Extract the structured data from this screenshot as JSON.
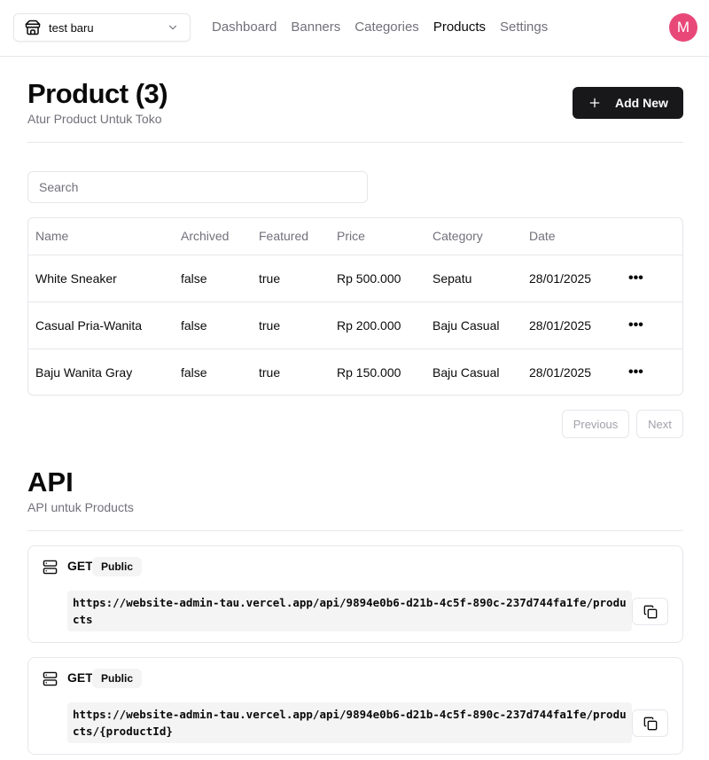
{
  "navbar": {
    "store_name": "test baru",
    "links": [
      "Dashboard",
      "Banners",
      "Categories",
      "Products",
      "Settings"
    ],
    "active_link": "Products",
    "avatar_initial": "M",
    "avatar_color": "#e84878"
  },
  "header": {
    "title": "Product (3)",
    "subtitle": "Atur Product Untuk Toko",
    "add_button_label": "Add New"
  },
  "search": {
    "placeholder": "Search",
    "value": ""
  },
  "table": {
    "columns": [
      "Name",
      "Archived",
      "Featured",
      "Price",
      "Category",
      "Date"
    ],
    "rows": [
      {
        "name": "White Sneaker",
        "archived": "false",
        "featured": "true",
        "price": "Rp 500.000",
        "category": "Sepatu",
        "date": "28/01/2025",
        "actions": "•••"
      },
      {
        "name": "Casual Pria-Wanita",
        "archived": "false",
        "featured": "true",
        "price": "Rp 200.000",
        "category": "Baju Casual",
        "date": "28/01/2025",
        "actions": "•••"
      },
      {
        "name": "Baju Wanita Gray",
        "archived": "false",
        "featured": "true",
        "price": "Rp 150.000",
        "category": "Baju Casual",
        "date": "28/01/2025",
        "actions": "•••"
      }
    ]
  },
  "pagination": {
    "previous_label": "Previous",
    "next_label": "Next"
  },
  "api": {
    "title": "API",
    "subtitle": "API untuk Products",
    "endpoints": [
      {
        "method": "GET",
        "badge": "Public",
        "url": "https://website-admin-tau.vercel.app/api/9894e0b6-d21b-4c5f-890c-237d744fa1fe/products"
      },
      {
        "method": "GET",
        "badge": "Public",
        "url": "https://website-admin-tau.vercel.app/api/9894e0b6-d21b-4c5f-890c-237d744fa1fe/products/{productId}"
      }
    ]
  },
  "icons": {
    "store_switcher": "store-icon",
    "store_chevron": "chevron-down-icon",
    "add": "plus-icon",
    "server": "server-icon",
    "copy": "copy-icon"
  }
}
